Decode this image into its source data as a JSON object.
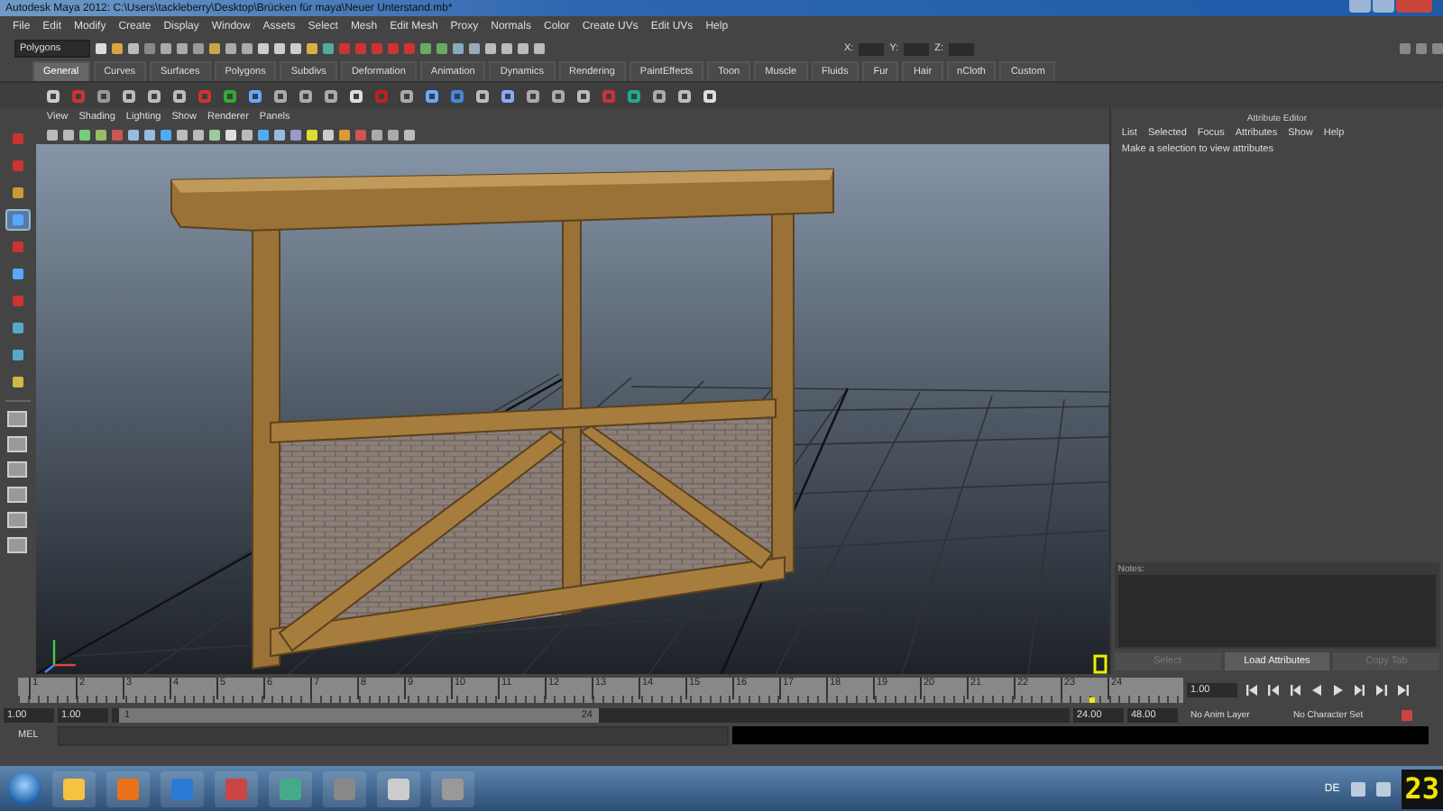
{
  "window": {
    "title": "Autodesk Maya 2012: C:\\Users\\tackleberry\\Desktop\\Brücken für maya\\Neuer Unterstand.mb*"
  },
  "menu": [
    "File",
    "Edit",
    "Modify",
    "Create",
    "Display",
    "Window",
    "Assets",
    "Select",
    "Mesh",
    "Edit Mesh",
    "Proxy",
    "Normals",
    "Color",
    "Create UVs",
    "Edit UVs",
    "Help"
  ],
  "status_line": {
    "mode": "Polygons",
    "coords": [
      "X:",
      "Y:",
      "Z:"
    ]
  },
  "shelf_tabs": [
    {
      "label": "General",
      "selected": true
    },
    {
      "label": "Curves",
      "selected": false
    },
    {
      "label": "Surfaces",
      "selected": false
    },
    {
      "label": "Polygons",
      "selected": false
    },
    {
      "label": "Subdivs",
      "selected": false
    },
    {
      "label": "Deformation",
      "selected": false
    },
    {
      "label": "Animation",
      "selected": false
    },
    {
      "label": "Dynamics",
      "selected": false
    },
    {
      "label": "Rendering",
      "selected": false
    },
    {
      "label": "PaintEffects",
      "selected": false
    },
    {
      "label": "Toon",
      "selected": false
    },
    {
      "label": "Muscle",
      "selected": false
    },
    {
      "label": "Fluids",
      "selected": false
    },
    {
      "label": "Fur",
      "selected": false
    },
    {
      "label": "Hair",
      "selected": false
    },
    {
      "label": "nCloth",
      "selected": false
    },
    {
      "label": "Custom",
      "selected": false
    }
  ],
  "toolbox": {
    "tools": [
      {
        "selected": false
      },
      {
        "selected": false
      },
      {
        "selected": false
      },
      {
        "selected": true
      },
      {
        "selected": false
      },
      {
        "selected": false
      },
      {
        "selected": false
      },
      {
        "selected": false
      },
      {
        "selected": false
      },
      {
        "selected": false
      }
    ]
  },
  "viewport": {
    "menu": [
      "View",
      "Shading",
      "Lighting",
      "Show",
      "Renderer",
      "Panels"
    ]
  },
  "attribute_editor": {
    "title": "Attribute Editor",
    "menu": [
      "List",
      "Selected",
      "Focus",
      "Attributes",
      "Show",
      "Help"
    ],
    "message": "Make a selection to view attributes",
    "notes_label": "Notes:",
    "buttons": [
      {
        "label": "Select",
        "disabled": true
      },
      {
        "label": "Load Attributes",
        "disabled": false
      },
      {
        "label": "Copy Tab",
        "disabled": true
      }
    ]
  },
  "timeline": {
    "frames": [
      "1",
      "2",
      "3",
      "4",
      "5",
      "6",
      "7",
      "8",
      "9",
      "10",
      "11",
      "12",
      "13",
      "14",
      "15",
      "16",
      "17",
      "18",
      "19",
      "20",
      "21",
      "22",
      "23",
      "24"
    ],
    "current_frame": "1.00",
    "level": 0.92
  },
  "range": {
    "start": "1.00",
    "playback_start": "1.00",
    "slider_start": "1",
    "slider_end": "24",
    "level": 0.5,
    "playback_end": "24.00",
    "end": "48.00",
    "anim_layer": "No Anim Layer",
    "character_set": "No Character Set"
  },
  "command_line": {
    "label": "MEL"
  },
  "taskbar": {
    "language": "DE",
    "overlay": "23"
  }
}
